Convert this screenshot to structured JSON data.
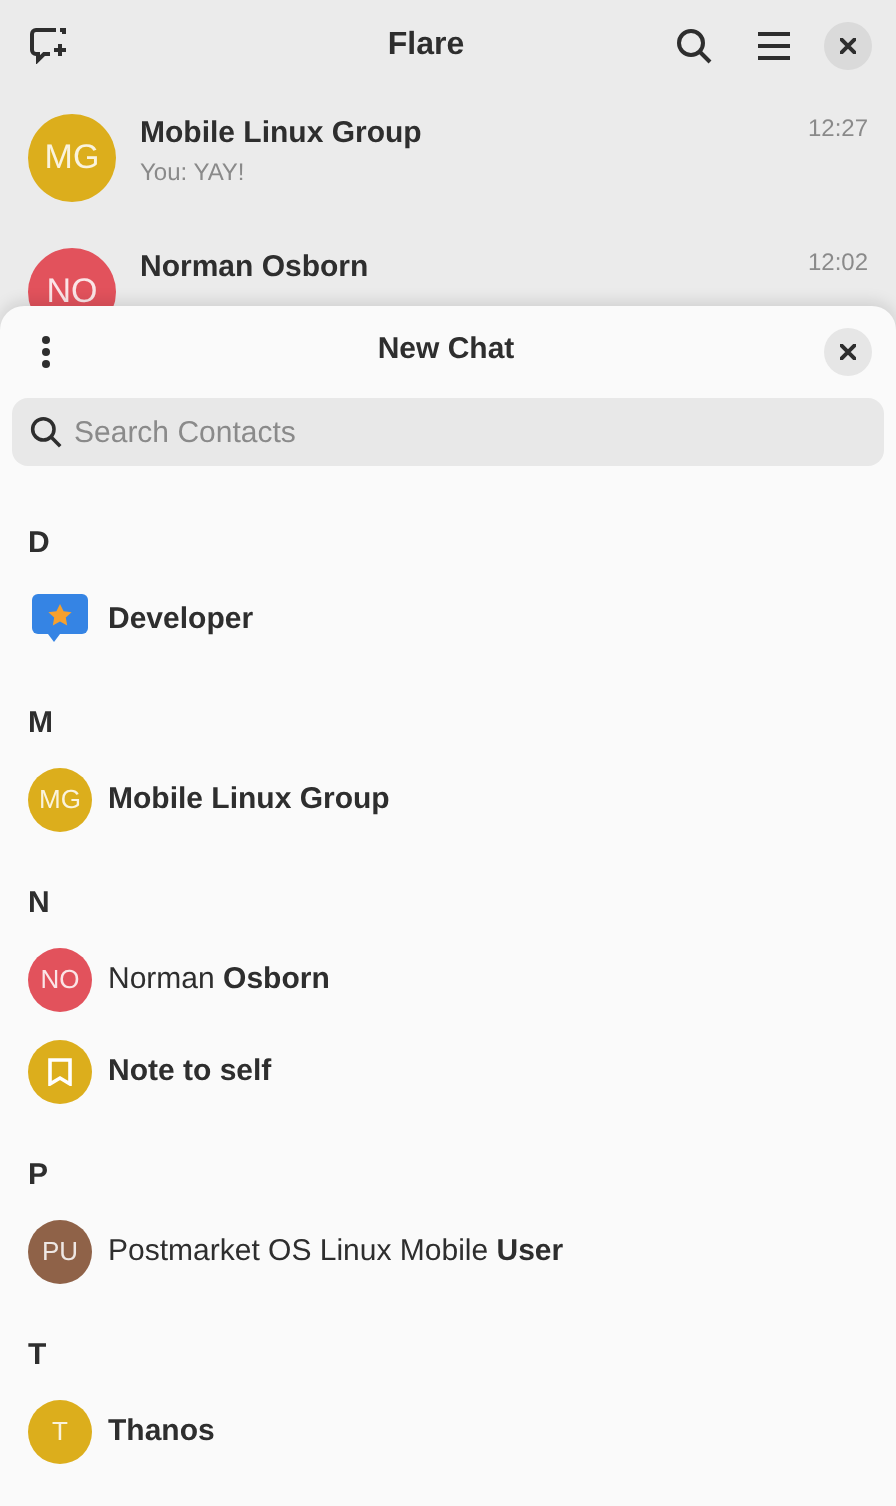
{
  "window": {
    "title": "Flare"
  },
  "chats": [
    {
      "name": "Mobile Linux Group",
      "preview": "You: YAY!",
      "time": "12:27",
      "initials": "MG",
      "color": "#dcae1c"
    },
    {
      "name": "Norman Osborn",
      "time": "12:02",
      "initials": "NO",
      "color": "#e2525c"
    }
  ],
  "sheet": {
    "title": "New Chat",
    "search": {
      "placeholder": "Search Contacts"
    }
  },
  "sections": [
    {
      "letter": "D",
      "contacts": [
        {
          "kind": "developer",
          "name": "Developer",
          "bold": true
        }
      ]
    },
    {
      "letter": "M",
      "contacts": [
        {
          "kind": "initials",
          "initials": "MG",
          "color": "#dcae1c",
          "name": "Mobile Linux Group",
          "bold": true
        }
      ]
    },
    {
      "letter": "N",
      "contacts": [
        {
          "kind": "initials",
          "initials": "NO",
          "color": "#e2525c",
          "name": "Norman **Osborn**",
          "bold": false
        },
        {
          "kind": "note",
          "color": "#dcae1c",
          "name": "Note to self",
          "bold": true
        }
      ]
    },
    {
      "letter": "P",
      "contacts": [
        {
          "kind": "initials",
          "initials": "PU",
          "color": "#8f6248",
          "name": "Postmarket OS Linux Mobile **User**",
          "bold": false
        }
      ]
    },
    {
      "letter": "T",
      "contacts": [
        {
          "kind": "initials",
          "initials": "T",
          "color": "#dcae1c",
          "name": "Thanos",
          "bold": true
        }
      ]
    }
  ]
}
